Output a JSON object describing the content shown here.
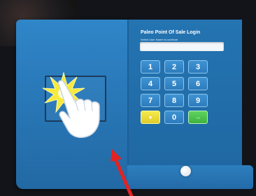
{
  "screen": {
    "title": "Paleo Point Of Sale Login",
    "prompt": "Select User Name to continue",
    "username_value": ""
  },
  "keypad": {
    "keys": [
      {
        "label": "1",
        "name": "key-1",
        "kind": "digit"
      },
      {
        "label": "2",
        "name": "key-2",
        "kind": "digit"
      },
      {
        "label": "3",
        "name": "key-3",
        "kind": "digit"
      },
      {
        "label": "4",
        "name": "key-4",
        "kind": "digit"
      },
      {
        "label": "5",
        "name": "key-5",
        "kind": "digit"
      },
      {
        "label": "6",
        "name": "key-6",
        "kind": "digit"
      },
      {
        "label": "7",
        "name": "key-7",
        "kind": "digit"
      },
      {
        "label": "8",
        "name": "key-8",
        "kind": "digit"
      },
      {
        "label": "9",
        "name": "key-9",
        "kind": "digit"
      },
      {
        "label": "",
        "name": "clear-key",
        "kind": "clear",
        "icon": "clear-icon",
        "color": "#f2e13c"
      },
      {
        "label": "0",
        "name": "key-0",
        "kind": "digit"
      },
      {
        "label": "",
        "name": "enter-key",
        "kind": "enter",
        "icon": "enter-arrow-icon",
        "color": "#4cc24c"
      }
    ]
  },
  "overlay": {
    "gesture_icon": "tap-hand-icon",
    "burst_icon": "tap-burst-icon",
    "arrow_icon": "pointer-arrow-icon",
    "arrow_color": "#e32222"
  },
  "colors": {
    "panel_blue": "#2a7bbd",
    "key_border": "#8cc6ee",
    "burst_yellow": "#f7ea3a"
  }
}
